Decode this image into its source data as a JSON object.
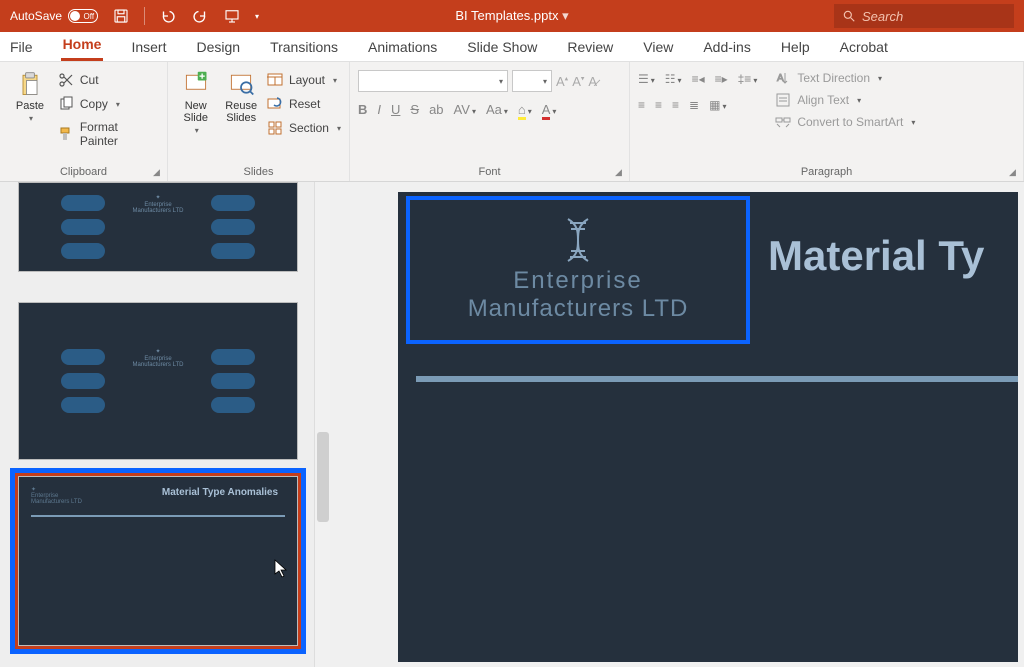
{
  "titlebar": {
    "autosave_label": "AutoSave",
    "autosave_state": "Off",
    "filename": "BI Templates.pptx",
    "search_placeholder": "Search"
  },
  "tabs": {
    "items": [
      "File",
      "Home",
      "Insert",
      "Design",
      "Transitions",
      "Animations",
      "Slide Show",
      "Review",
      "View",
      "Add-ins",
      "Help",
      "Acrobat"
    ],
    "active_index": 1
  },
  "ribbon": {
    "clipboard": {
      "label": "Clipboard",
      "paste": "Paste",
      "cut": "Cut",
      "copy": "Copy",
      "format_painter": "Format Painter"
    },
    "slides": {
      "label": "Slides",
      "new_slide": "New\nSlide",
      "reuse_slides": "Reuse\nSlides",
      "layout": "Layout",
      "reset": "Reset",
      "section": "Section"
    },
    "font": {
      "label": "Font"
    },
    "paragraph": {
      "label": "Paragraph",
      "text_direction": "Text Direction",
      "align_text": "Align Text",
      "convert_smartart": "Convert to SmartArt"
    }
  },
  "slide": {
    "company_line1": "Enterprise",
    "company_line2": "Manufacturers LTD",
    "title": "Material Ty",
    "thumb_title": "Material Type Anomalies",
    "thumb_logo_l1": "Enterprise",
    "thumb_logo_l2": "Manufacturers LTD"
  }
}
